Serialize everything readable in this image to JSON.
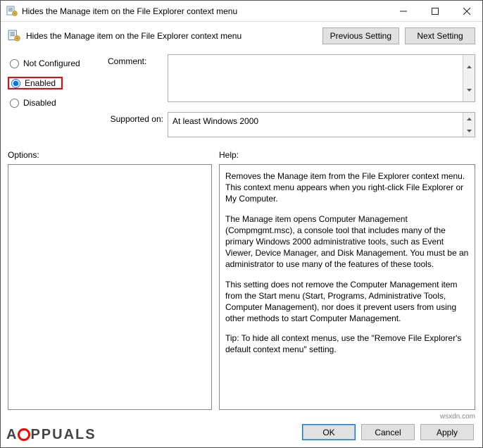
{
  "title": "Hides the Manage item on the File Explorer context menu",
  "header": {
    "title": "Hides the Manage item on the File Explorer context menu"
  },
  "nav": {
    "prev": "Previous Setting",
    "next": "Next Setting"
  },
  "state": {
    "options": [
      {
        "label": "Not Configured",
        "checked": false
      },
      {
        "label": "Enabled",
        "checked": true,
        "highlight": true
      },
      {
        "label": "Disabled",
        "checked": false
      }
    ]
  },
  "labels": {
    "comment": "Comment:",
    "supported": "Supported on:",
    "options": "Options:",
    "help": "Help:"
  },
  "comment": "",
  "supported": "At least Windows 2000",
  "help_paragraphs": [
    "Removes the Manage item from the File Explorer context menu. This context menu appears when you right-click File Explorer or My Computer.",
    "The Manage item opens Computer Management (Compmgmt.msc), a console tool that includes many of the primary Windows 2000 administrative tools, such as Event Viewer, Device Manager, and Disk Management. You must be an administrator to use many of the features of these tools.",
    "This setting does not remove the Computer Management item from the Start menu (Start, Programs, Administrative Tools, Computer Management), nor does it prevent users from using other methods to start Computer Management.",
    "Tip: To hide all context menus, use the \"Remove File Explorer's default context menu\" setting."
  ],
  "buttons": {
    "ok": "OK",
    "cancel": "Cancel",
    "apply": "Apply"
  },
  "credit": "wsxdn.com",
  "watermark": "PPUALS"
}
